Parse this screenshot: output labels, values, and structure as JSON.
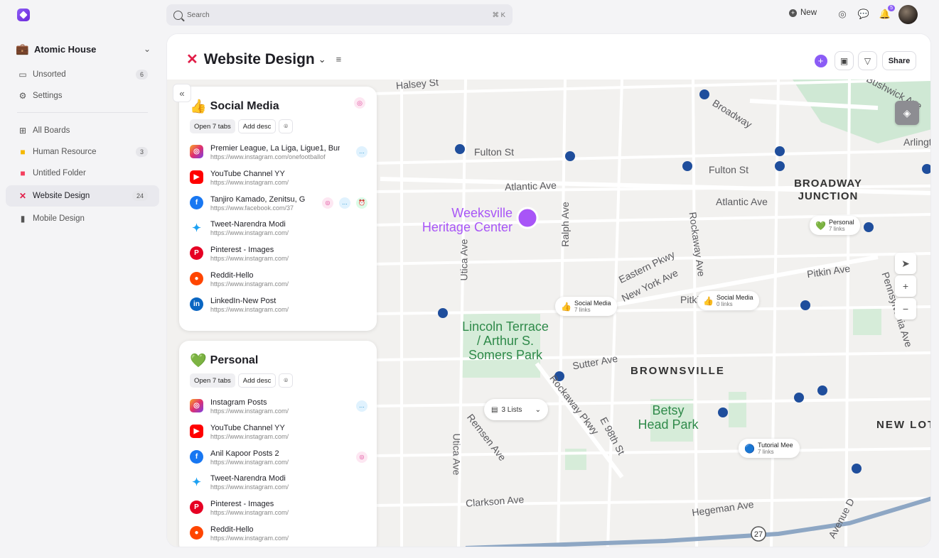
{
  "workspace": {
    "name": "Atomic House",
    "emoji": "💼"
  },
  "sidebar": {
    "items": [
      {
        "label": "Unsorted",
        "count": "6"
      },
      {
        "label": "Settings"
      },
      {
        "label": "All Boards"
      },
      {
        "label": "Human Resource",
        "count": "3"
      },
      {
        "label": "Untitled Folder"
      },
      {
        "label": "Website Design",
        "count": "24"
      },
      {
        "label": "Mobile Design"
      }
    ]
  },
  "search": {
    "placeholder": "Search",
    "shortcut": "⌘ K"
  },
  "topbar": {
    "new_label": "New",
    "notification_count": "5"
  },
  "board": {
    "title": "Website Design",
    "share_label": "Share"
  },
  "cards": [
    {
      "emoji": "👍",
      "title": "Social Media",
      "open_label": "Open 7 tabs",
      "desc_label": "Add desc",
      "links": [
        {
          "title": "Premier League, La Liga, Ligue1, Bun",
          "url": "https://www.instagram.com/onefootballof",
          "icon": "instagram-icon"
        },
        {
          "title": "YouTube Channel YY",
          "url": "https://www.instagram.com/",
          "icon": "youtube-icon"
        },
        {
          "title": "Tanjiro Kamado, Zenitsu, G",
          "url": "https://www.facebook.com/37",
          "icon": "facebook-icon"
        },
        {
          "title": "Tweet-Narendra Modi",
          "url": "https://www.instagram.com/",
          "icon": "twitter-icon"
        },
        {
          "title": "Pinterest - Images",
          "url": "https://www.instagram.com/",
          "icon": "pinterest-icon"
        },
        {
          "title": "Reddit-Hello",
          "url": "https://www.instagram.com/",
          "icon": "reddit-icon"
        },
        {
          "title": "LinkedIn-New Post",
          "url": "https://www.instagram.com/",
          "icon": "linkedin-icon"
        }
      ]
    },
    {
      "emoji": "💚",
      "title": "Personal",
      "open_label": "Open 7 tabs",
      "desc_label": "Add desc",
      "links": [
        {
          "title": "Instagram Posts",
          "url": "https://www.instagram.com/",
          "icon": "instagram-icon"
        },
        {
          "title": "YouTube Channel YY",
          "url": "https://www.instagram.com/",
          "icon": "youtube-icon"
        },
        {
          "title": "Anil Kapoor Posts 2",
          "url": "https://www.instagram.com/",
          "icon": "facebook-icon"
        },
        {
          "title": "Tweet-Narendra Modi",
          "url": "https://www.instagram.com/",
          "icon": "twitter-icon"
        },
        {
          "title": "Pinterest - Images",
          "url": "https://www.instagram.com/",
          "icon": "pinterest-icon"
        },
        {
          "title": "Reddit-Hello",
          "url": "https://www.instagram.com/",
          "icon": "reddit-icon"
        }
      ]
    }
  ],
  "map": {
    "streets": [
      "Halsey St",
      "Fulton St",
      "Fulton St",
      "Atlantic Ave",
      "Atlantic Ave",
      "Broadway",
      "Rockaway Ave",
      "Ralph Ave",
      "Utica Ave",
      "Eastern Pkwy",
      "New York Ave",
      "Pitkin Ave",
      "Pitkin Ave",
      "Sutter Ave",
      "Rockaway Pkwy",
      "E 98th St",
      "Remsen Ave",
      "Utica Ave",
      "Clarkson Ave",
      "Hegeman Ave",
      "Avenue D",
      "Pennsylvania Ave",
      "Bushwick Ave",
      "Arlington"
    ],
    "places": [
      "Weeksville Heritage Center",
      "Lincoln Terrace / Arthur S. Somers Park",
      "Betsy Head Park"
    ],
    "neighborhoods": [
      "BROADWAY JUNCTION",
      "BROWNSVILLE",
      "NEW LOT"
    ],
    "route_number": "27",
    "pins": [
      {
        "emoji": "💚",
        "name": "Personal",
        "links": "7 links"
      },
      {
        "emoji": "👍",
        "name": "Social Media",
        "links": "7 links"
      },
      {
        "emoji": "👍",
        "name": "Social Media",
        "links": "0 links"
      },
      {
        "emoji": "🔵",
        "name": "Tutorial Mee",
        "links": "7 links"
      }
    ],
    "lists_selector": "3 Lists"
  },
  "colors": {
    "accent": "#8b5cf6",
    "board_icon": "#e11d48",
    "map_park": "#cfe8d4",
    "map_road": "#ffffff"
  }
}
